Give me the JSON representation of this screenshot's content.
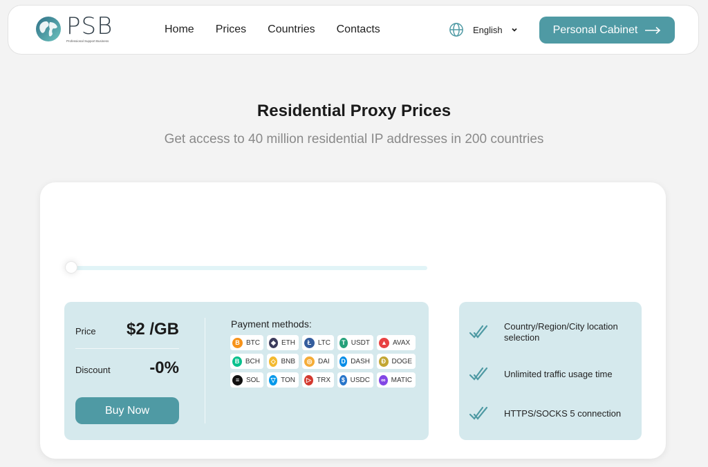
{
  "header": {
    "logo": {
      "name": "PSB",
      "tagline": "Professional Support Business"
    },
    "nav": [
      "Home",
      "Prices",
      "Countries",
      "Contacts"
    ],
    "language": {
      "icon": "globe-icon",
      "selected": "English"
    },
    "cabinet_button": "Personal Cabinet"
  },
  "hero": {
    "title": "Residential Proxy Prices",
    "subtitle": "Get access to 40 million residential IP addresses in 200 countries"
  },
  "pricing": {
    "slider": {
      "position_fraction": 0
    },
    "price_label": "Price",
    "price_value": "$2 /GB",
    "discount_label": "Discount",
    "discount_value": "-0%",
    "buy_button": "Buy Now",
    "payment_title": "Payment methods:",
    "coins": [
      {
        "code": "BTC",
        "color": "#f7931a",
        "glyph": "B"
      },
      {
        "code": "ETH",
        "color": "#3c3c5d",
        "glyph": "◆"
      },
      {
        "code": "LTC",
        "color": "#345d9d",
        "glyph": "Ł"
      },
      {
        "code": "USDT",
        "color": "#26a17b",
        "glyph": "T"
      },
      {
        "code": "AVAX",
        "color": "#e84142",
        "glyph": "▲"
      },
      {
        "code": "BCH",
        "color": "#0ac18e",
        "glyph": "B"
      },
      {
        "code": "BNB",
        "color": "#f3ba2f",
        "glyph": "◇"
      },
      {
        "code": "DAI",
        "color": "#f5ac37",
        "glyph": "◎"
      },
      {
        "code": "DASH",
        "color": "#008ce7",
        "glyph": "D"
      },
      {
        "code": "DOGE",
        "color": "#c2a633",
        "glyph": "Đ"
      },
      {
        "code": "SOL",
        "color": "#111111",
        "glyph": "≡"
      },
      {
        "code": "TON",
        "color": "#0098ea",
        "glyph": "▽"
      },
      {
        "code": "TRX",
        "color": "#d3392f",
        "glyph": "▷"
      },
      {
        "code": "USDC",
        "color": "#2775ca",
        "glyph": "$"
      },
      {
        "code": "MATIC",
        "color": "#8247e5",
        "glyph": "∞"
      }
    ]
  },
  "features": [
    "Country/Region/City location selection",
    "Unlimited traffic usage time",
    "HTTPS/SOCKS 5 connection"
  ],
  "colors": {
    "accent": "#4f9aa4",
    "panel": "#d5e9ed",
    "background": "#f3f3f3"
  }
}
